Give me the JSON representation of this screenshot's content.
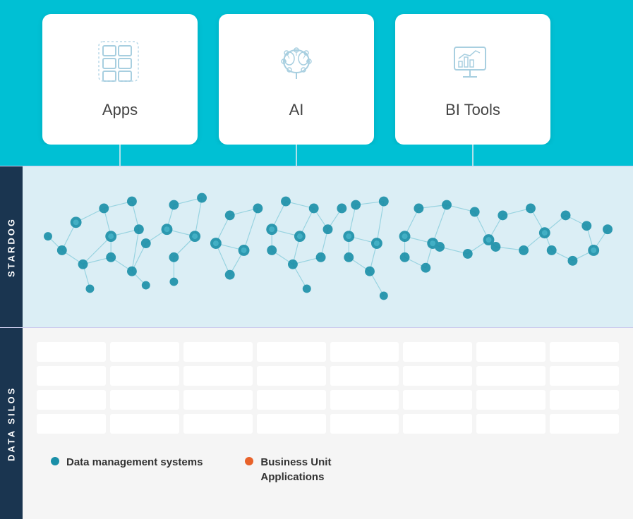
{
  "cards": [
    {
      "id": "apps",
      "label": "Apps",
      "icon": "apps"
    },
    {
      "id": "ai",
      "label": "AI",
      "icon": "ai"
    },
    {
      "id": "bi",
      "label": "BI Tools",
      "icon": "bi"
    }
  ],
  "stardog": {
    "label": "STARDOG"
  },
  "datasilos": {
    "label": "DATA SILOS"
  },
  "legend": [
    {
      "color": "blue",
      "text": "Data management systems"
    },
    {
      "color": "orange",
      "text": "Business Unit\nApplications"
    }
  ]
}
